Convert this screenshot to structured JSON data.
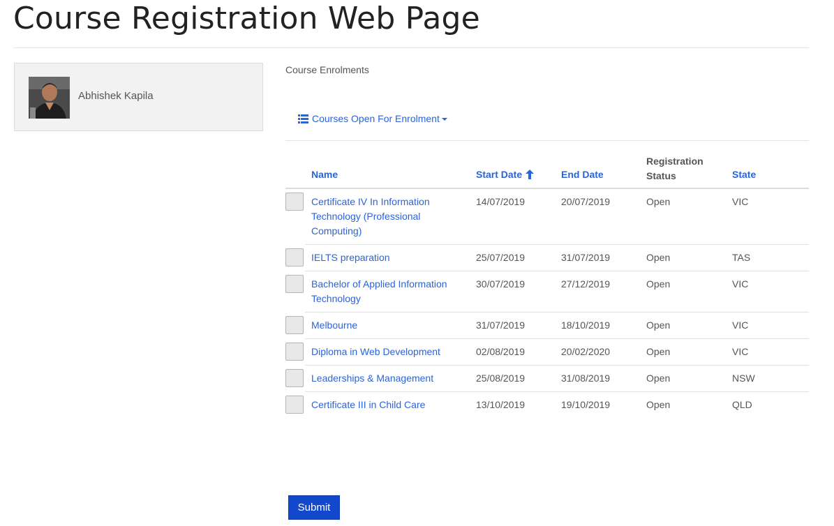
{
  "page": {
    "title": "Course Registration Web Page"
  },
  "user": {
    "name": "Abhishek Kapila",
    "avatar_icon": "user-photo"
  },
  "enrolments": {
    "section_label": "Course Enrolments",
    "menu": {
      "label": "Courses Open For Enrolment",
      "icon": "list-icon"
    },
    "table": {
      "headers": {
        "name": "Name",
        "start_date": "Start Date",
        "end_date": "End Date",
        "status_line1": "Registration",
        "status_line2": "Status",
        "state": "State"
      },
      "sort": {
        "column": "start_date",
        "direction": "ascending"
      },
      "rows": [
        {
          "name": "Certificate IV In Information Technology (Professional Computing)",
          "start": "14/07/2019",
          "end": "20/07/2019",
          "status": "Open",
          "state": "VIC"
        },
        {
          "name": "IELTS preparation",
          "start": "25/07/2019",
          "end": "31/07/2019",
          "status": "Open",
          "state": "TAS"
        },
        {
          "name": "Bachelor of Applied Information Technology",
          "start": "30/07/2019",
          "end": "27/12/2019",
          "status": "Open",
          "state": "VIC"
        },
        {
          "name": "Melbourne",
          "start": "31/07/2019",
          "end": "18/10/2019",
          "status": "Open",
          "state": "VIC"
        },
        {
          "name": "Diploma in Web Development",
          "start": "02/08/2019",
          "end": "20/02/2020",
          "status": "Open",
          "state": "VIC"
        },
        {
          "name": "Leaderships & Management",
          "start": "25/08/2019",
          "end": "31/08/2019",
          "status": "Open",
          "state": "NSW"
        },
        {
          "name": "Certificate III in Child Care",
          "start": "13/10/2019",
          "end": "19/10/2019",
          "status": "Open",
          "state": "QLD"
        }
      ]
    }
  },
  "actions": {
    "submit_label": "Submit"
  },
  "colors": {
    "link": "#2b63d9",
    "submit_bg": "#1248cc",
    "card_bg": "#f2f2f2"
  }
}
